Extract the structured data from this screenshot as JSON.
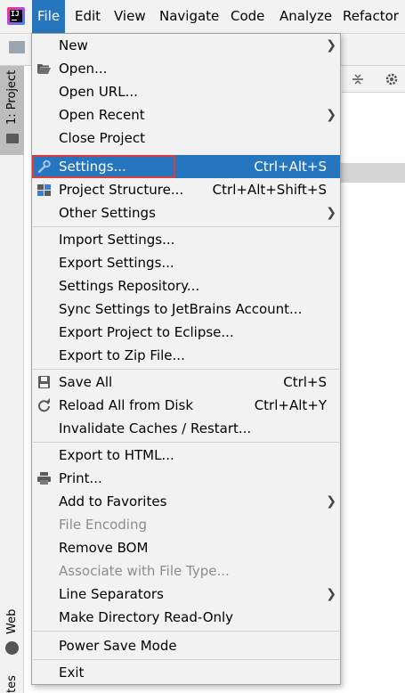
{
  "menubar": {
    "items": [
      "File",
      "Edit",
      "View",
      "Navigate",
      "Code",
      "Analyze",
      "Refactor"
    ]
  },
  "sidebar": {
    "project_tab": "1: Project",
    "web_tab": "Web",
    "bottom_tab": "tes"
  },
  "file_menu": {
    "groups": [
      [
        {
          "label": "New",
          "submenu": true
        },
        {
          "label": "Open...",
          "icon": "folder-open-icon"
        },
        {
          "label": "Open URL..."
        },
        {
          "label": "Open Recent",
          "submenu": true
        },
        {
          "label": "Close Project"
        },
        {
          "label": "Settings...",
          "shortcut": "Ctrl+Alt+S",
          "icon": "wrench-icon",
          "highlighted": true
        },
        {
          "label": "Project Structure...",
          "shortcut": "Ctrl+Alt+Shift+S",
          "icon": "project-structure-icon"
        },
        {
          "label": "Other Settings",
          "submenu": true
        }
      ],
      [
        {
          "label": "Import Settings..."
        },
        {
          "label": "Export Settings..."
        },
        {
          "label": "Settings Repository..."
        },
        {
          "label": "Sync Settings to JetBrains Account..."
        },
        {
          "label": "Export Project to Eclipse..."
        },
        {
          "label": "Export to Zip File..."
        }
      ],
      [
        {
          "label": "Save All",
          "shortcut": "Ctrl+S",
          "icon": "save-icon"
        },
        {
          "label": "Reload All from Disk",
          "shortcut": "Ctrl+Alt+Y",
          "icon": "reload-icon"
        },
        {
          "label": "Invalidate Caches / Restart..."
        }
      ],
      [
        {
          "label": "Export to HTML..."
        },
        {
          "label": "Print...",
          "icon": "printer-icon"
        },
        {
          "label": "Add to Favorites",
          "submenu": true
        },
        {
          "label": "File Encoding",
          "disabled": true
        },
        {
          "label": "Remove BOM"
        },
        {
          "label": "Associate with File Type...",
          "disabled": true
        },
        {
          "label": "Line Separators",
          "submenu": true
        },
        {
          "label": "Make Directory Read-Only"
        }
      ],
      [
        {
          "label": "Power Save Mode"
        }
      ],
      [
        {
          "label": "Exit"
        }
      ]
    ]
  },
  "colors": {
    "highlight": "#2675bf",
    "annotation_box": "#e0393e",
    "menu_background": "#f2f2f2",
    "disabled_text": "#8c8c8c"
  }
}
